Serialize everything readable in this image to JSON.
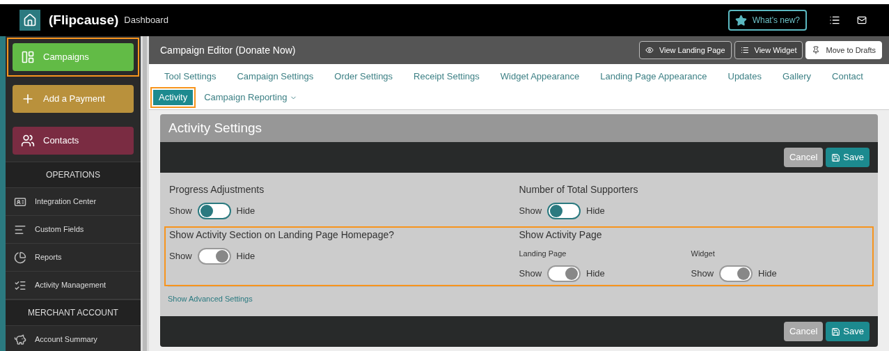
{
  "topbar": {
    "logo": "(Flipcause)",
    "subtitle": "Dashboard",
    "whats_new": "What's new?"
  },
  "sidebar": {
    "buttons": [
      {
        "label": "Campaigns",
        "color": "#62bb46",
        "highlighted": true
      },
      {
        "label": "Add a Payment",
        "color": "#b9913c",
        "highlighted": false
      },
      {
        "label": "Contacts",
        "color": "#7a2c42",
        "highlighted": false
      }
    ],
    "sections": [
      {
        "title": "OPERATIONS",
        "items": [
          {
            "label": "Integration Center"
          },
          {
            "label": "Custom Fields"
          },
          {
            "label": "Reports"
          },
          {
            "label": "Activity Management"
          }
        ]
      },
      {
        "title": "MERCHANT ACCOUNT",
        "items": [
          {
            "label": "Account Summary"
          }
        ]
      }
    ]
  },
  "editor": {
    "title": "Campaign Editor (Donate Now)",
    "actions": [
      {
        "label": "View Landing Page",
        "kind": "outline"
      },
      {
        "label": "View Widget",
        "kind": "outline"
      },
      {
        "label": "Move to Drafts",
        "kind": "solid"
      }
    ]
  },
  "tabs": [
    {
      "label": "Tool Settings",
      "selected": false,
      "highlighted": false,
      "dropdown": false
    },
    {
      "label": "Campaign Settings",
      "selected": false,
      "highlighted": false,
      "dropdown": false
    },
    {
      "label": "Order Settings",
      "selected": false,
      "highlighted": false,
      "dropdown": false
    },
    {
      "label": "Receipt Settings",
      "selected": false,
      "highlighted": false,
      "dropdown": false
    },
    {
      "label": "Widget Appearance",
      "selected": false,
      "highlighted": false,
      "dropdown": false
    },
    {
      "label": "Landing Page Appearance",
      "selected": false,
      "highlighted": false,
      "dropdown": false
    },
    {
      "label": "Updates",
      "selected": false,
      "highlighted": false,
      "dropdown": false
    },
    {
      "label": "Gallery",
      "selected": false,
      "highlighted": false,
      "dropdown": false
    },
    {
      "label": "Contact",
      "selected": false,
      "highlighted": false,
      "dropdown": false
    },
    {
      "label": "Activity",
      "selected": true,
      "highlighted": true,
      "dropdown": false
    },
    {
      "label": "Campaign Reporting",
      "selected": false,
      "highlighted": false,
      "dropdown": true
    }
  ],
  "panel": {
    "title": "Activity Settings",
    "top_buttons": [
      {
        "label": "Cancel",
        "kind": "cancel"
      },
      {
        "label": "Save",
        "kind": "save"
      }
    ],
    "rows": [
      {
        "highlighted": false,
        "groups": [
          {
            "title": "Progress Adjustments",
            "toggles": [
              {
                "show": "Show",
                "hide": "Hide",
                "hidden": false
              }
            ]
          },
          {
            "title": "Number of Total Supporters",
            "toggles": [
              {
                "show": "Show",
                "hide": "Hide",
                "hidden": false
              }
            ]
          }
        ]
      },
      {
        "highlighted": true,
        "groups": [
          {
            "title": "Show Activity Section on Landing Page Homepage?",
            "toggles": [
              {
                "show": "Show",
                "hide": "Hide",
                "hidden": true
              }
            ]
          },
          {
            "title": "Show Activity Page",
            "toggles": [
              {
                "label": "Landing Page",
                "show": "Show",
                "hide": "Hide",
                "hidden": true
              },
              {
                "label": "Widget",
                "show": "Show",
                "hide": "Hide",
                "hidden": true
              }
            ]
          }
        ]
      }
    ],
    "advanced_link": "Show Advanced Settings",
    "bottom_buttons": [
      {
        "label": "Cancel",
        "kind": "cancel"
      },
      {
        "label": "Save",
        "kind": "save"
      }
    ]
  }
}
